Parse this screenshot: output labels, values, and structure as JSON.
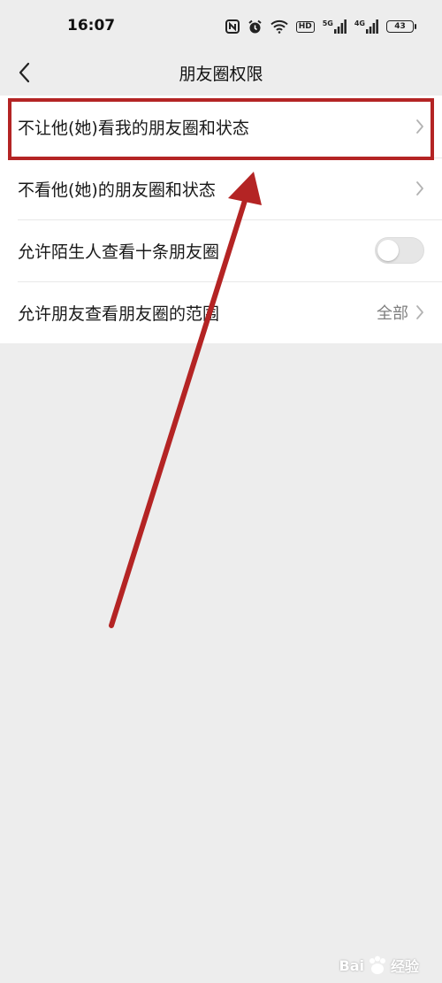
{
  "status_bar": {
    "time": "16:07",
    "network_1": "5G",
    "network_2": "4G",
    "hd": "HD",
    "battery": "43",
    "icons": [
      "nfc-icon",
      "alarm-icon",
      "wifi-icon",
      "hd-icon",
      "signal-icon",
      "signal-icon",
      "battery-icon"
    ]
  },
  "nav": {
    "title": "朋友圈权限",
    "back_icon": "chevron-left-icon"
  },
  "settings": {
    "items": [
      {
        "label": "不让他(她)看我的朋友圈和状态",
        "type": "link"
      },
      {
        "label": "不看他(她)的朋友圈和状态",
        "type": "link"
      },
      {
        "label": "允许陌生人查看十条朋友圈",
        "type": "toggle",
        "enabled": false
      },
      {
        "label": "允许朋友查看朋友圈的范围",
        "type": "link",
        "value": "全部"
      }
    ]
  },
  "annotation": {
    "highlight_color": "#b42424",
    "arrow_color": "#b42424"
  },
  "watermark": {
    "brand_left": "Bai",
    "brand_right": "经验"
  },
  "colors": {
    "background": "#ededed",
    "card": "#ffffff",
    "text": "#191919",
    "secondary_text": "#7f7f7f"
  }
}
